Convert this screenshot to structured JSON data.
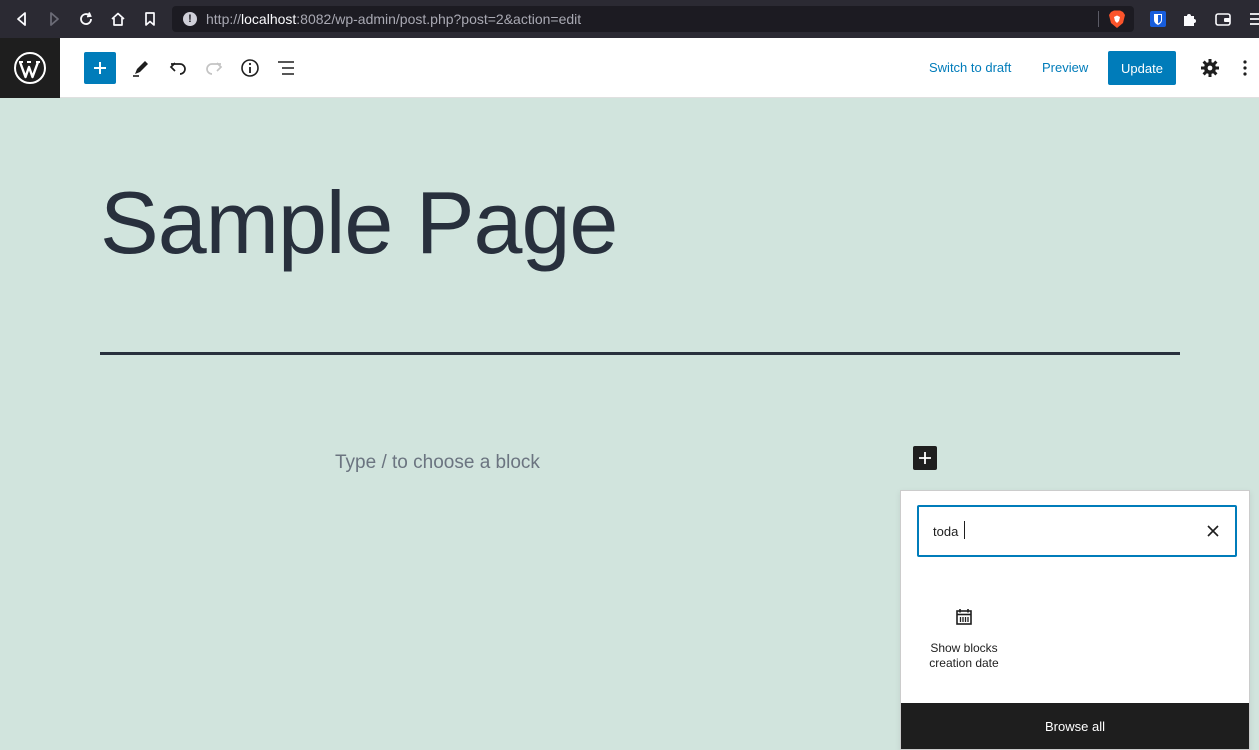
{
  "browser": {
    "url_prefix": "http://",
    "url_host": "localhost",
    "url_rest": ":8082/wp-admin/post.php?post=2&action=edit",
    "icons": [
      "back-icon",
      "forward-icon",
      "reload-icon",
      "home-icon",
      "bookmark-icon",
      "info-icon",
      "brave-shield-icon",
      "bitwarden-icon",
      "extensions-icon",
      "wallet-icon",
      "menu-icon"
    ]
  },
  "toolbar": {
    "logo_icon": "wordpress-icon",
    "switch_to_draft": "Switch to draft",
    "preview": "Preview",
    "update": "Update",
    "icons": [
      "add-block-icon",
      "pen-icon",
      "undo-icon",
      "redo-icon",
      "info-icon",
      "list-view-icon",
      "settings-icon",
      "more-icon"
    ],
    "accent": "#007cba"
  },
  "canvas": {
    "title": "Sample Page",
    "placeholder": "Type / to choose a block",
    "background": "#d1e4dd"
  },
  "inserter": {
    "search_value": "toda",
    "results": [
      {
        "label_line1": "Show blocks",
        "label_line2": "creation date",
        "icon": "calendar-icon"
      }
    ],
    "browse_all": "Browse all"
  }
}
